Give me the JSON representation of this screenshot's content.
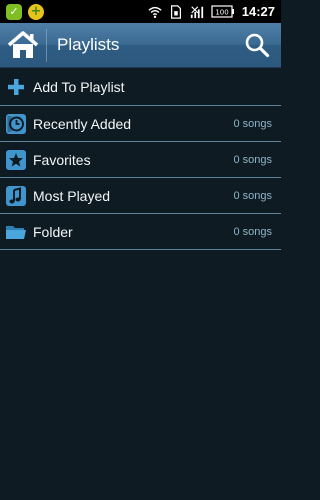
{
  "status_bar": {
    "time": "14:27",
    "battery": "100",
    "icons": [
      "app-green-icon",
      "app-yellow-icon",
      "wifi-icon",
      "sim-icon",
      "no-signal-icon",
      "battery-icon"
    ]
  },
  "action_bar": {
    "title": "Playlists",
    "home_icon": "home-icon",
    "search_icon": "search-icon"
  },
  "list": {
    "items": [
      {
        "label": "Add To Playlist",
        "icon": "plus-icon",
        "count": ""
      },
      {
        "label": "Recently Added",
        "icon": "clock-icon",
        "count": "0 songs"
      },
      {
        "label": "Favorites",
        "icon": "star-icon",
        "count": "0 songs"
      },
      {
        "label": "Most Played",
        "icon": "music-note-icon",
        "count": "0 songs"
      },
      {
        "label": "Folder",
        "icon": "folder-icon",
        "count": "0 songs"
      }
    ]
  },
  "colors": {
    "background": "#0f1b22",
    "action_bar": "#3b6b92",
    "accent_icon": "#4aa6dd",
    "count_text": "#8fb3c9",
    "divider": "#5f8398"
  }
}
